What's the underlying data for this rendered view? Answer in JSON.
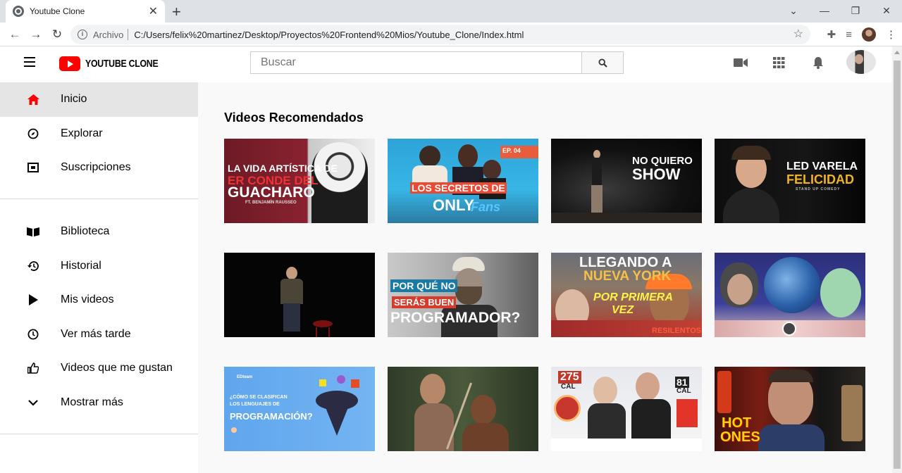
{
  "browser": {
    "tab_title": "Youtube Clone",
    "tab_close": "✕",
    "new_tab": "+",
    "url_scheme": "Archivo",
    "url": "C:/Users/felix%20martinez/Desktop/Proyectos%20Frontend%20Mios/Youtube_Clone/Index.html",
    "back": "←",
    "forward": "→",
    "reload": "↻",
    "star": "☆",
    "minimize": "—",
    "restore": "❐",
    "close": "✕",
    "menu": "⋮"
  },
  "header": {
    "logo_text": "YOUTUBE CLONE",
    "search_placeholder": "Buscar"
  },
  "sidebar": {
    "items": [
      {
        "label": "Inicio",
        "icon": "home-icon"
      },
      {
        "label": "Explorar",
        "icon": "compass-icon"
      },
      {
        "label": "Suscripciones",
        "icon": "subscriptions-icon"
      }
    ],
    "library_items": [
      {
        "label": "Biblioteca",
        "icon": "library-icon"
      },
      {
        "label": "Historial",
        "icon": "history-icon"
      },
      {
        "label": "Mis videos",
        "icon": "play-icon"
      },
      {
        "label": "Ver más tarde",
        "icon": "clock-icon"
      },
      {
        "label": "Videos que me gustan",
        "icon": "thumbs-up-icon"
      },
      {
        "label": "Mostrar más",
        "icon": "chevron-down-icon"
      }
    ]
  },
  "main": {
    "section_title": "Videos Recomendados",
    "videos": [
      {
        "text": "LA VIDA ARTÍSTICA DE",
        "text2": "ER CONDE DEL",
        "text3": "GUACHARO",
        "text4": "FT. BENJAMÍN RAUSSEO"
      },
      {
        "text": "LOS SECRETOS DE",
        "text2": "ONLY",
        "text3": "Fans",
        "text4": "EP. 04"
      },
      {
        "text": "NO QUIERO",
        "text2": "SHOW"
      },
      {
        "text": "LED VARELA",
        "text2": "FELICIDAD",
        "text3": "STAND UP COMEDY"
      },
      {
        "text": ""
      },
      {
        "text": "POR QUÉ NO",
        "text2": "SERÁS BUEN",
        "text3": "PROGRAMADOR?"
      },
      {
        "text": "LLEGANDO A",
        "text2": "NUEVA YORK",
        "text3": "POR PRIMERA",
        "text4": "VEZ",
        "text5": "RESILENTOS"
      },
      {
        "text": ""
      },
      {
        "text": "¿CÓMO SE CLASIFICAN",
        "text2": "LOS LENGUAJES DE",
        "text3": "PROGRAMACIÓN?",
        "text4": "EDteam"
      },
      {
        "text": ""
      },
      {
        "text": "275",
        "text2": "CAL",
        "text3": "81",
        "text4": "CAL"
      },
      {
        "text": "HOT",
        "text2": "ONES"
      }
    ]
  }
}
